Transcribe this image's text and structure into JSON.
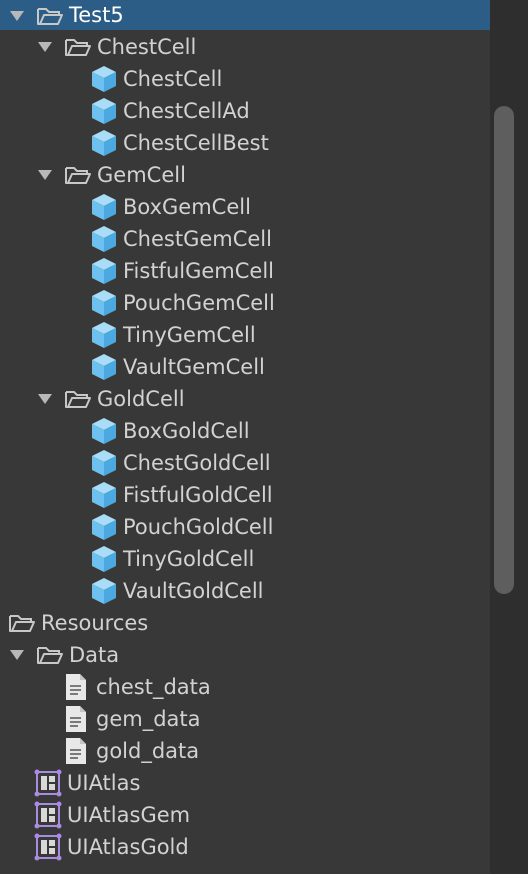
{
  "tree": {
    "items": [
      {
        "label": "Test5",
        "level": 0,
        "icon": "folder-open-icon",
        "expanded": true,
        "selected": true
      },
      {
        "label": "ChestCell",
        "level": 1,
        "icon": "folder-open-icon",
        "expanded": true
      },
      {
        "label": "ChestCell",
        "level": 2,
        "icon": "prefab-cube-icon"
      },
      {
        "label": "ChestCellAd",
        "level": 2,
        "icon": "prefab-cube-icon"
      },
      {
        "label": "ChestCellBest",
        "level": 2,
        "icon": "prefab-cube-icon"
      },
      {
        "label": "GemCell",
        "level": 1,
        "icon": "folder-open-icon",
        "expanded": true
      },
      {
        "label": "BoxGemCell",
        "level": 2,
        "icon": "prefab-cube-icon"
      },
      {
        "label": "ChestGemCell",
        "level": 2,
        "icon": "prefab-cube-icon"
      },
      {
        "label": "FistfulGemCell",
        "level": 2,
        "icon": "prefab-cube-icon"
      },
      {
        "label": "PouchGemCell",
        "level": 2,
        "icon": "prefab-cube-icon"
      },
      {
        "label": "TinyGemCell",
        "level": 2,
        "icon": "prefab-cube-icon"
      },
      {
        "label": "VaultGemCell",
        "level": 2,
        "icon": "prefab-cube-icon"
      },
      {
        "label": "GoldCell",
        "level": 1,
        "icon": "folder-open-icon",
        "expanded": true
      },
      {
        "label": "BoxGoldCell",
        "level": 2,
        "icon": "prefab-cube-icon"
      },
      {
        "label": "ChestGoldCell",
        "level": 2,
        "icon": "prefab-cube-icon"
      },
      {
        "label": "FistfulGoldCell",
        "level": 2,
        "icon": "prefab-cube-icon"
      },
      {
        "label": "PouchGoldCell",
        "level": 2,
        "icon": "prefab-cube-icon"
      },
      {
        "label": "TinyGoldCell",
        "level": 2,
        "icon": "prefab-cube-icon"
      },
      {
        "label": "VaultGoldCell",
        "level": 2,
        "icon": "prefab-cube-icon"
      },
      {
        "label": "Resources",
        "level": 0,
        "icon": "folder-open-icon",
        "expanded": false,
        "leaf": true
      },
      {
        "label": "Data",
        "level": 0,
        "icon": "folder-open-icon",
        "expanded": true
      },
      {
        "label": "chest_data",
        "level": 2,
        "icon": "text-file-icon"
      },
      {
        "label": "gem_data",
        "level": 2,
        "icon": "text-file-icon"
      },
      {
        "label": "gold_data",
        "level": 2,
        "icon": "text-file-icon"
      },
      {
        "label": "UIAtlas",
        "level": 1,
        "icon": "sprite-atlas-icon"
      },
      {
        "label": "UIAtlasGem",
        "level": 1,
        "icon": "sprite-atlas-icon"
      },
      {
        "label": "UIAtlasGold",
        "level": 1,
        "icon": "sprite-atlas-icon"
      }
    ]
  },
  "colors": {
    "background": "#383838",
    "selection": "#2c5d87",
    "prefab": "#7cc9f2",
    "atlas": "#a98be0"
  }
}
